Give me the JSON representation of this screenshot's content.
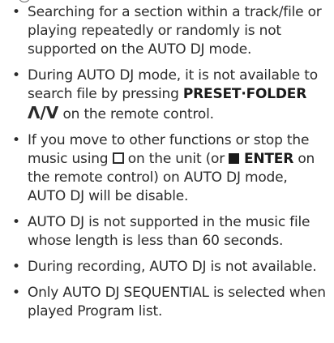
{
  "notes": [
    {
      "text": "Searching for a section within a track/file or playing repeatedly or randomly is not supported on the AUTO DJ mode."
    },
    {
      "before": "During AUTO DJ mode, it is not available to search file by pressing ",
      "button_label": "PRESET·FOLDER",
      "arrows": "Λ/V",
      "after": " on the remote control."
    },
    {
      "part1": "If you move to other functions or stop the music using ",
      "part2": " on the unit (or ",
      "button_label": " ENTER",
      "part3": " on the remote control) on AUTO DJ mode, AUTO DJ will be disable.",
      "icons": [
        "stop-outline-icon",
        "stop-filled-icon"
      ]
    },
    {
      "text": "AUTO DJ is not supported in the music file whose length is less than 60 seconds."
    },
    {
      "text": "During recording, AUTO DJ is not available."
    },
    {
      "text": "Only AUTO DJ SEQUENTIAL is selected when played Program list."
    }
  ],
  "bullet": "•"
}
